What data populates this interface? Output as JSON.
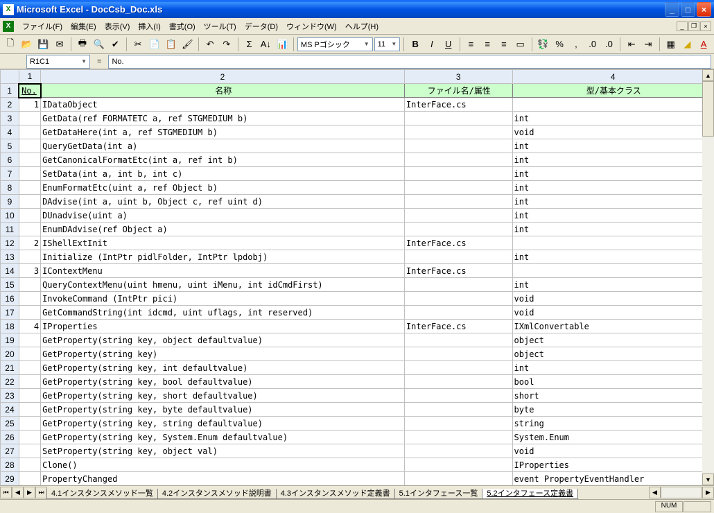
{
  "title": "Microsoft Excel - DocCsb_Doc.xls",
  "menus": [
    "ファイル(F)",
    "編集(E)",
    "表示(V)",
    "挿入(I)",
    "書式(O)",
    "ツール(T)",
    "データ(D)",
    "ウィンドウ(W)",
    "ヘルプ(H)"
  ],
  "font_name": "MS Pゴシック",
  "font_size": "11",
  "name_box": "R1C1",
  "formula_prefix": "=",
  "formula_value": "No.",
  "col_headers": [
    "1",
    "2",
    "3",
    "4"
  ],
  "header_row": {
    "c1": "No.",
    "c2": "名称",
    "c3": "ファイル名/属性",
    "c4": "型/基本クラス"
  },
  "rows": [
    {
      "n": "1",
      "name": "IDataObject",
      "file": "InterFace.cs",
      "type": ""
    },
    {
      "n": "",
      "name": "GetData(ref FORMATETC a, ref STGMEDIUM b)",
      "file": "",
      "type": "int"
    },
    {
      "n": "",
      "name": "GetDataHere(int a, ref STGMEDIUM b)",
      "file": "",
      "type": "void"
    },
    {
      "n": "",
      "name": "QueryGetData(int a)",
      "file": "",
      "type": "int"
    },
    {
      "n": "",
      "name": "GetCanonicalFormatEtc(int a, ref int b)",
      "file": "",
      "type": "int"
    },
    {
      "n": "",
      "name": "SetData(int a, int b, int c)",
      "file": "",
      "type": "int"
    },
    {
      "n": "",
      "name": "EnumFormatEtc(uint a, ref Object b)",
      "file": "",
      "type": "int"
    },
    {
      "n": "",
      "name": "DAdvise(int a, uint b, Object c, ref uint d)",
      "file": "",
      "type": "int"
    },
    {
      "n": "",
      "name": "DUnadvise(uint a)",
      "file": "",
      "type": "int"
    },
    {
      "n": "",
      "name": "EnumDAdvise(ref Object a)",
      "file": "",
      "type": "int"
    },
    {
      "n": "2",
      "name": "IShellExtInit",
      "file": "InterFace.cs",
      "type": ""
    },
    {
      "n": "",
      "name": "Initialize (IntPtr pidlFolder, IntPtr lpdobj)",
      "file": "",
      "type": "int"
    },
    {
      "n": "3",
      "name": "IContextMenu",
      "file": "InterFace.cs",
      "type": ""
    },
    {
      "n": "",
      "name": "QueryContextMenu(uint hmenu, uint iMenu, int idCmdFirst)",
      "file": "",
      "type": "int"
    },
    {
      "n": "",
      "name": "InvokeCommand (IntPtr pici)",
      "file": "",
      "type": "void"
    },
    {
      "n": "",
      "name": "GetCommandString(int idcmd, uint uflags, int reserved)",
      "file": "",
      "type": "void"
    },
    {
      "n": "4",
      "name": "IProperties",
      "file": "InterFace.cs",
      "type": "IXmlConvertable"
    },
    {
      "n": "",
      "name": "GetProperty(string key, object defaultvalue)",
      "file": "",
      "type": "object"
    },
    {
      "n": "",
      "name": "GetProperty(string key)",
      "file": "",
      "type": "object"
    },
    {
      "n": "",
      "name": "GetProperty(string key, int defaultvalue)",
      "file": "",
      "type": "int"
    },
    {
      "n": "",
      "name": "GetProperty(string key, bool defaultvalue)",
      "file": "",
      "type": "bool"
    },
    {
      "n": "",
      "name": "GetProperty(string key, short defaultvalue)",
      "file": "",
      "type": "short"
    },
    {
      "n": "",
      "name": "GetProperty(string key, byte defaultvalue)",
      "file": "",
      "type": "byte"
    },
    {
      "n": "",
      "name": "GetProperty(string key, string defaultvalue)",
      "file": "",
      "type": "string"
    },
    {
      "n": "",
      "name": "GetProperty(string key, System.Enum defaultvalue)",
      "file": "",
      "type": "System.Enum"
    },
    {
      "n": "",
      "name": "SetProperty(string key, object val)",
      "file": "",
      "type": "void"
    },
    {
      "n": "",
      "name": "Clone()",
      "file": "",
      "type": "IProperties"
    },
    {
      "n": "",
      "name": "PropertyChanged",
      "file": "",
      "type": "event PropertyEventHandler"
    }
  ],
  "tabs": [
    "4.1インスタンスメソッド一覧",
    "4.2インスタンスメソッド説明書",
    "4.3インスタンスメソッド定義書",
    "5.1インタフェース一覧",
    "5.2インタフェース定義書"
  ],
  "active_tab": 4,
  "status_cells": [
    "NUM",
    ""
  ]
}
